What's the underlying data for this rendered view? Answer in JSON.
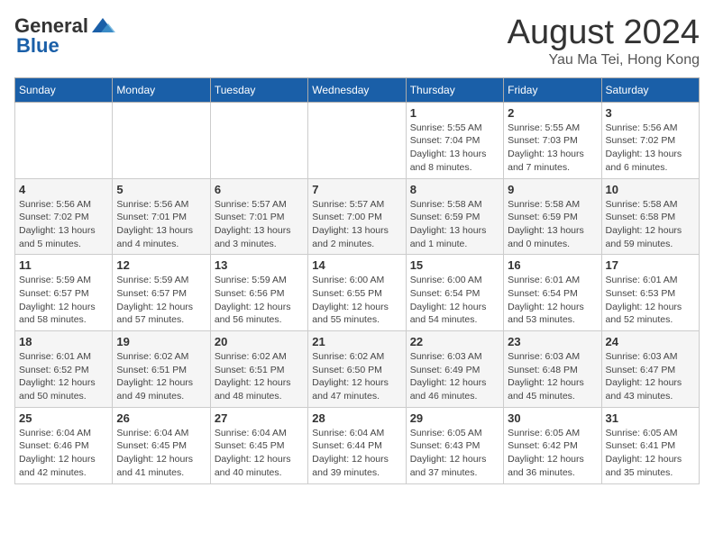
{
  "header": {
    "logo": {
      "general": "General",
      "blue": "Blue"
    },
    "title": "August 2024",
    "location": "Yau Ma Tei, Hong Kong"
  },
  "days_of_week": [
    "Sunday",
    "Monday",
    "Tuesday",
    "Wednesday",
    "Thursday",
    "Friday",
    "Saturday"
  ],
  "weeks": [
    {
      "days": [
        {
          "num": "",
          "info": ""
        },
        {
          "num": "",
          "info": ""
        },
        {
          "num": "",
          "info": ""
        },
        {
          "num": "",
          "info": ""
        },
        {
          "num": "1",
          "info": "Sunrise: 5:55 AM\nSunset: 7:04 PM\nDaylight: 13 hours\nand 8 minutes."
        },
        {
          "num": "2",
          "info": "Sunrise: 5:55 AM\nSunset: 7:03 PM\nDaylight: 13 hours\nand 7 minutes."
        },
        {
          "num": "3",
          "info": "Sunrise: 5:56 AM\nSunset: 7:02 PM\nDaylight: 13 hours\nand 6 minutes."
        }
      ]
    },
    {
      "days": [
        {
          "num": "4",
          "info": "Sunrise: 5:56 AM\nSunset: 7:02 PM\nDaylight: 13 hours\nand 5 minutes."
        },
        {
          "num": "5",
          "info": "Sunrise: 5:56 AM\nSunset: 7:01 PM\nDaylight: 13 hours\nand 4 minutes."
        },
        {
          "num": "6",
          "info": "Sunrise: 5:57 AM\nSunset: 7:01 PM\nDaylight: 13 hours\nand 3 minutes."
        },
        {
          "num": "7",
          "info": "Sunrise: 5:57 AM\nSunset: 7:00 PM\nDaylight: 13 hours\nand 2 minutes."
        },
        {
          "num": "8",
          "info": "Sunrise: 5:58 AM\nSunset: 6:59 PM\nDaylight: 13 hours\nand 1 minute."
        },
        {
          "num": "9",
          "info": "Sunrise: 5:58 AM\nSunset: 6:59 PM\nDaylight: 13 hours\nand 0 minutes."
        },
        {
          "num": "10",
          "info": "Sunrise: 5:58 AM\nSunset: 6:58 PM\nDaylight: 12 hours\nand 59 minutes."
        }
      ]
    },
    {
      "days": [
        {
          "num": "11",
          "info": "Sunrise: 5:59 AM\nSunset: 6:57 PM\nDaylight: 12 hours\nand 58 minutes."
        },
        {
          "num": "12",
          "info": "Sunrise: 5:59 AM\nSunset: 6:57 PM\nDaylight: 12 hours\nand 57 minutes."
        },
        {
          "num": "13",
          "info": "Sunrise: 5:59 AM\nSunset: 6:56 PM\nDaylight: 12 hours\nand 56 minutes."
        },
        {
          "num": "14",
          "info": "Sunrise: 6:00 AM\nSunset: 6:55 PM\nDaylight: 12 hours\nand 55 minutes."
        },
        {
          "num": "15",
          "info": "Sunrise: 6:00 AM\nSunset: 6:54 PM\nDaylight: 12 hours\nand 54 minutes."
        },
        {
          "num": "16",
          "info": "Sunrise: 6:01 AM\nSunset: 6:54 PM\nDaylight: 12 hours\nand 53 minutes."
        },
        {
          "num": "17",
          "info": "Sunrise: 6:01 AM\nSunset: 6:53 PM\nDaylight: 12 hours\nand 52 minutes."
        }
      ]
    },
    {
      "days": [
        {
          "num": "18",
          "info": "Sunrise: 6:01 AM\nSunset: 6:52 PM\nDaylight: 12 hours\nand 50 minutes."
        },
        {
          "num": "19",
          "info": "Sunrise: 6:02 AM\nSunset: 6:51 PM\nDaylight: 12 hours\nand 49 minutes."
        },
        {
          "num": "20",
          "info": "Sunrise: 6:02 AM\nSunset: 6:51 PM\nDaylight: 12 hours\nand 48 minutes."
        },
        {
          "num": "21",
          "info": "Sunrise: 6:02 AM\nSunset: 6:50 PM\nDaylight: 12 hours\nand 47 minutes."
        },
        {
          "num": "22",
          "info": "Sunrise: 6:03 AM\nSunset: 6:49 PM\nDaylight: 12 hours\nand 46 minutes."
        },
        {
          "num": "23",
          "info": "Sunrise: 6:03 AM\nSunset: 6:48 PM\nDaylight: 12 hours\nand 45 minutes."
        },
        {
          "num": "24",
          "info": "Sunrise: 6:03 AM\nSunset: 6:47 PM\nDaylight: 12 hours\nand 43 minutes."
        }
      ]
    },
    {
      "days": [
        {
          "num": "25",
          "info": "Sunrise: 6:04 AM\nSunset: 6:46 PM\nDaylight: 12 hours\nand 42 minutes."
        },
        {
          "num": "26",
          "info": "Sunrise: 6:04 AM\nSunset: 6:45 PM\nDaylight: 12 hours\nand 41 minutes."
        },
        {
          "num": "27",
          "info": "Sunrise: 6:04 AM\nSunset: 6:45 PM\nDaylight: 12 hours\nand 40 minutes."
        },
        {
          "num": "28",
          "info": "Sunrise: 6:04 AM\nSunset: 6:44 PM\nDaylight: 12 hours\nand 39 minutes."
        },
        {
          "num": "29",
          "info": "Sunrise: 6:05 AM\nSunset: 6:43 PM\nDaylight: 12 hours\nand 37 minutes."
        },
        {
          "num": "30",
          "info": "Sunrise: 6:05 AM\nSunset: 6:42 PM\nDaylight: 12 hours\nand 36 minutes."
        },
        {
          "num": "31",
          "info": "Sunrise: 6:05 AM\nSunset: 6:41 PM\nDaylight: 12 hours\nand 35 minutes."
        }
      ]
    }
  ]
}
